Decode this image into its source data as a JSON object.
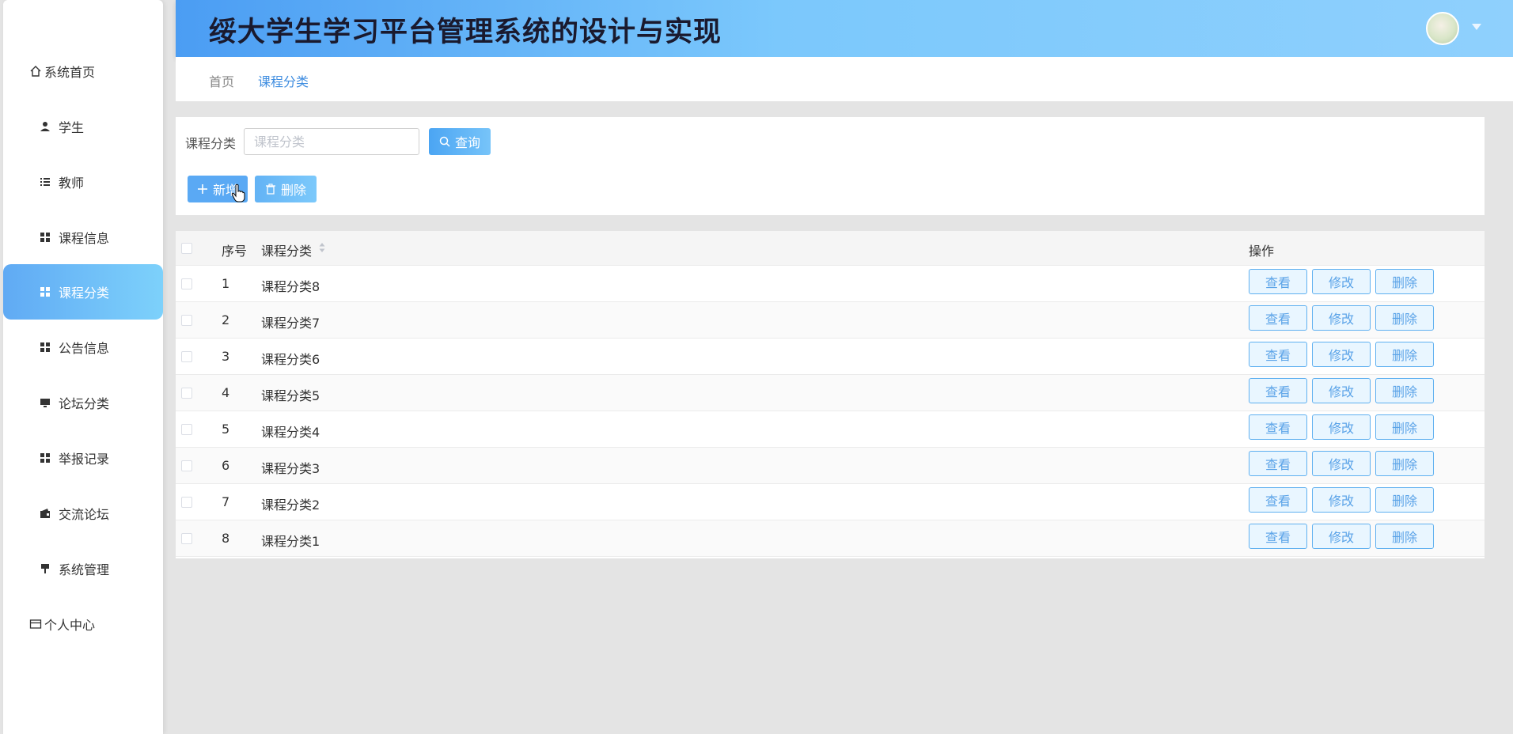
{
  "header": {
    "title": "绥大学生学习平台管理系统的设计与实现"
  },
  "sidebar": {
    "items": [
      {
        "label": "系统首页",
        "icon": "home-icon"
      },
      {
        "label": "学生",
        "icon": "user-icon"
      },
      {
        "label": "教师",
        "icon": "list-icon"
      },
      {
        "label": "课程信息",
        "icon": "grid-icon"
      },
      {
        "label": "课程分类",
        "icon": "grid-icon",
        "active": true
      },
      {
        "label": "公告信息",
        "icon": "grid-icon"
      },
      {
        "label": "论坛分类",
        "icon": "monitor-icon"
      },
      {
        "label": "举报记录",
        "icon": "grid-icon"
      },
      {
        "label": "交流论坛",
        "icon": "wallet-icon"
      },
      {
        "label": "系统管理",
        "icon": "brush-icon"
      },
      {
        "label": "个人中心",
        "icon": "card-icon"
      }
    ]
  },
  "breadcrumb": {
    "home": "首页",
    "current": "课程分类"
  },
  "search": {
    "label": "课程分类",
    "placeholder": "课程分类",
    "query_label": "查询"
  },
  "actions": {
    "add_label": "新增",
    "delete_label": "删除"
  },
  "table": {
    "headers": {
      "index": "序号",
      "category": "课程分类",
      "actions": "操作"
    },
    "rows": [
      {
        "index": "1",
        "category": "课程分类8"
      },
      {
        "index": "2",
        "category": "课程分类7"
      },
      {
        "index": "3",
        "category": "课程分类6"
      },
      {
        "index": "4",
        "category": "课程分类5"
      },
      {
        "index": "5",
        "category": "课程分类4"
      },
      {
        "index": "6",
        "category": "课程分类3"
      },
      {
        "index": "7",
        "category": "课程分类2"
      },
      {
        "index": "8",
        "category": "课程分类1"
      }
    ],
    "row_actions": {
      "view": "查看",
      "edit": "修改",
      "delete": "删除"
    }
  },
  "colors": {
    "accent": "#5aa9f4",
    "header_gradient_start": "#4b9df3",
    "header_gradient_end": "#8fd0fd"
  }
}
